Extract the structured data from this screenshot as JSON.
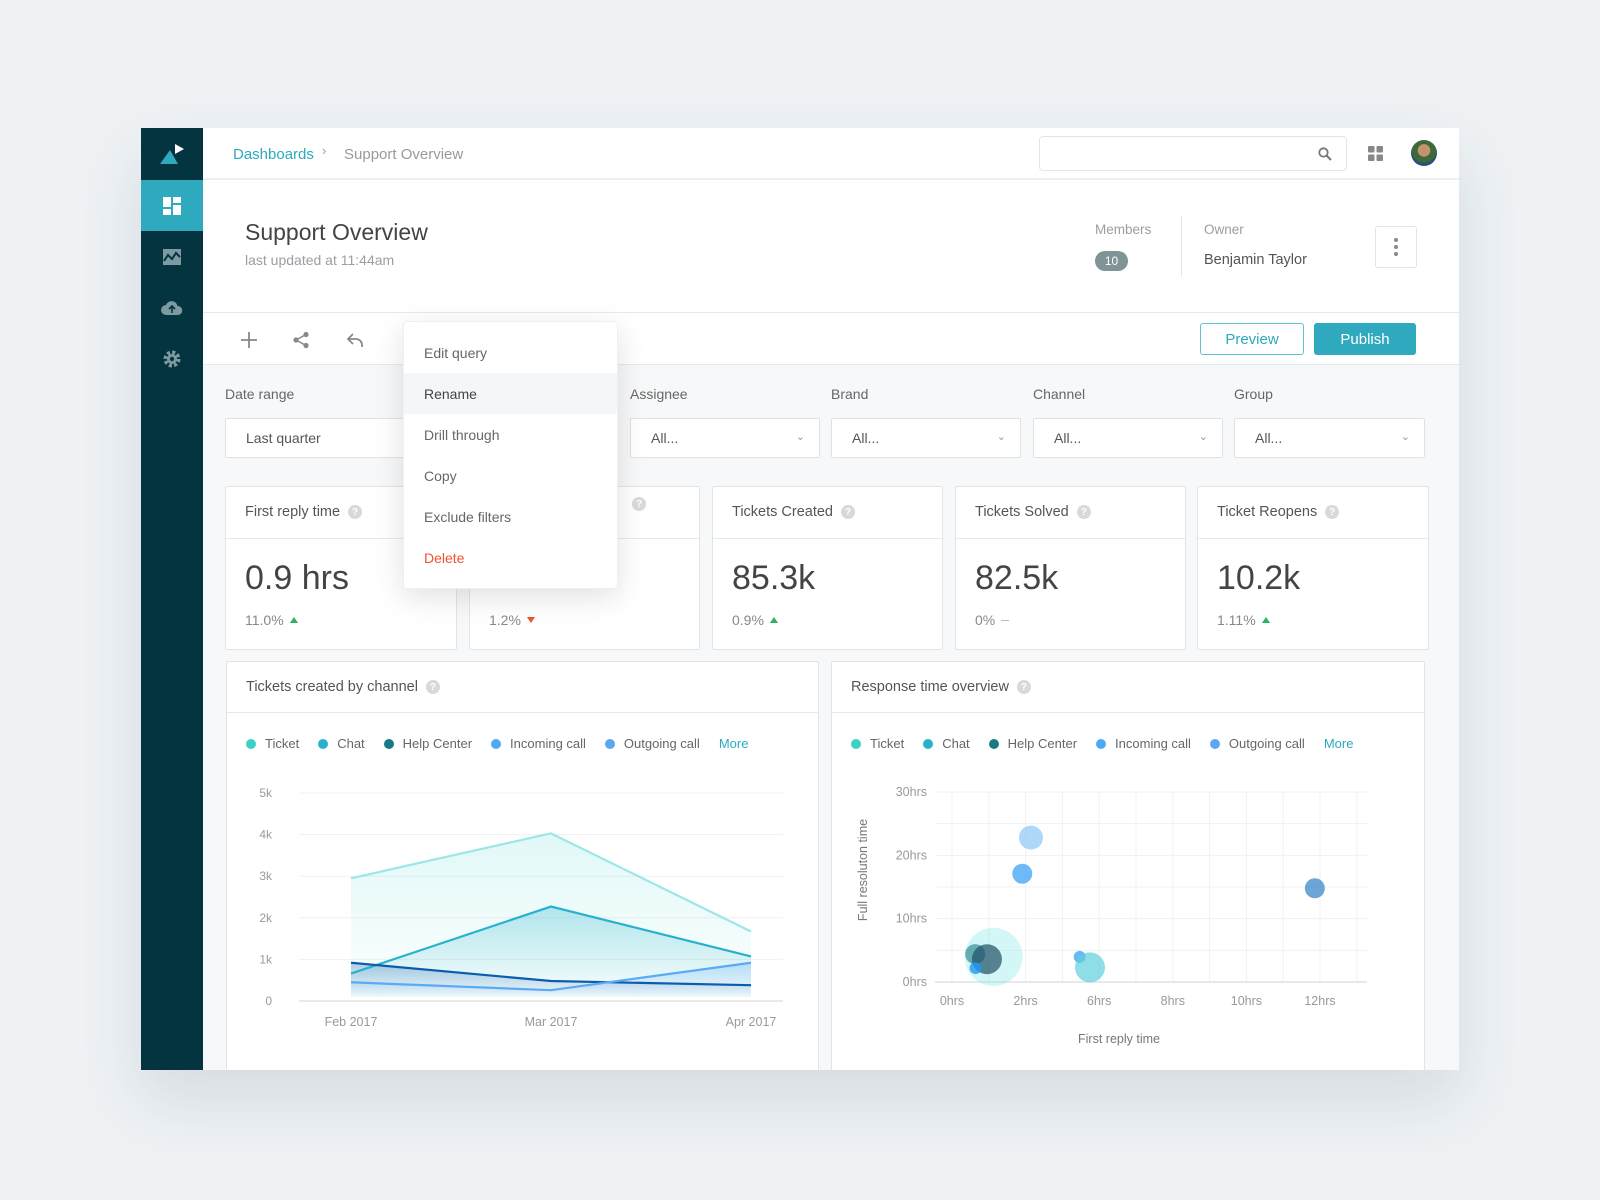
{
  "breadcrumb": {
    "root": "Dashboards",
    "separator": "›",
    "current": "Support Overview"
  },
  "search": {
    "placeholder": "",
    "value": ""
  },
  "header": {
    "title": "Support Overview",
    "subtitle": "last updated at 11:44am",
    "members_label": "Members",
    "members_count": "10",
    "owner_label": "Owner",
    "owner_name": "Benjamin Taylor"
  },
  "toolbar": {
    "preview": "Preview",
    "publish": "Publish"
  },
  "context_menu": {
    "items": [
      {
        "label": "Edit query"
      },
      {
        "label": "Rename",
        "highlighted": true
      },
      {
        "label": "Drill through"
      },
      {
        "label": "Copy"
      },
      {
        "label": "Exclude filters"
      },
      {
        "label": "Delete",
        "color": "#f0532e"
      }
    ]
  },
  "filters": [
    {
      "label": "Date range",
      "value": "Last quarter"
    },
    {
      "label": "Assignee",
      "value": "All..."
    },
    {
      "label": "Brand",
      "value": "All..."
    },
    {
      "label": "Channel",
      "value": "All..."
    },
    {
      "label": "Group",
      "value": "All..."
    }
  ],
  "kpis": [
    {
      "title": "First reply time",
      "value": "0.9 hrs",
      "delta": "11.0%",
      "trend": "up"
    },
    {
      "title": "",
      "value": "",
      "delta": "1.2%",
      "trend": "down"
    },
    {
      "title": "Tickets Created",
      "value": "85.3k",
      "delta": "0.9%",
      "trend": "up"
    },
    {
      "title": "Tickets Solved",
      "value": "82.5k",
      "delta": "0%",
      "trend": "flat"
    },
    {
      "title": "Ticket Reopens",
      "value": "10.2k",
      "delta": "1.11%",
      "trend": "up"
    }
  ],
  "legend": {
    "items": [
      {
        "label": "Ticket",
        "color": "#3ecfc6"
      },
      {
        "label": "Chat",
        "color": "#27b2cb"
      },
      {
        "label": "Help Center",
        "color": "#1a7a84"
      },
      {
        "label": "Incoming call",
        "color": "#4fa9f0"
      },
      {
        "label": "Outgoing call",
        "color": "#5ba7f3"
      }
    ],
    "more": "More"
  },
  "colors": {
    "accent": "#2ea9bd",
    "sidebar": "#04343f",
    "danger": "#f0532e",
    "success": "#27b35a"
  },
  "chart_data": [
    {
      "type": "area",
      "title": "Tickets created by channel",
      "categories": [
        "Feb 2017",
        "Mar 2017",
        "Apr 2017"
      ],
      "ylim": [
        0,
        5000
      ],
      "yticks": [
        {
          "v": 0,
          "label": "0"
        },
        {
          "v": 1000,
          "label": "1k"
        },
        {
          "v": 2000,
          "label": "2k"
        },
        {
          "v": 3000,
          "label": "3k"
        },
        {
          "v": 4000,
          "label": "4k"
        },
        {
          "v": 5000,
          "label": "5k"
        }
      ],
      "grid": true,
      "legend": "top-left",
      "series": [
        {
          "name": "Ticket",
          "values": [
            2950,
            4030,
            1670
          ],
          "color": "#9ae7e6"
        },
        {
          "name": "Chat",
          "values": [
            660,
            2270,
            1070
          ],
          "color": "#27b2cb"
        },
        {
          "name": "Help Center",
          "values": [
            920,
            480,
            380
          ],
          "color": "#0b5cab"
        },
        {
          "name": "Incoming call",
          "values": [
            450,
            260,
            920
          ],
          "color": "#5aaaf5"
        }
      ]
    },
    {
      "type": "scatter",
      "title": "Response time overview",
      "xlabel": "First reply time",
      "ylabel": "Full resoluton time",
      "xticks": [
        {
          "v": 0,
          "label": "0hrs"
        },
        {
          "v": 2,
          "label": "2hrs"
        },
        {
          "v": 6,
          "label": "6hrs"
        },
        {
          "v": 8,
          "label": "8hrs"
        },
        {
          "v": 10,
          "label": "10hrs"
        },
        {
          "v": 12,
          "label": "12hrs"
        }
      ],
      "yticks": [
        {
          "v": 0,
          "label": "0hrs"
        },
        {
          "v": 10,
          "label": "10hrs"
        },
        {
          "v": 20,
          "label": "20hrs"
        },
        {
          "v": 30,
          "label": "30hrs"
        }
      ],
      "ylim": [
        0,
        30
      ],
      "grid": true,
      "legend": "top-left",
      "points": [
        {
          "series": "Ticket",
          "x": 1.13,
          "y": 3.96,
          "size": 29,
          "color": "#7ee8e6",
          "opacity": 0.35
        },
        {
          "series": "Help Center",
          "x": 0.63,
          "y": 4.4,
          "size": 10,
          "color": "#1a7a84",
          "opacity": 0.6
        },
        {
          "series": "Help Center",
          "x": 0.95,
          "y": 3.6,
          "size": 15,
          "color": "#1f4f66",
          "opacity": 0.7
        },
        {
          "series": "Incoming call",
          "x": 0.64,
          "y": 2.2,
          "size": 6,
          "color": "#2196f3",
          "opacity": 0.8
        },
        {
          "series": "Incoming call",
          "x": 4.94,
          "y": 3.96,
          "size": 6,
          "color": "#42a5f5",
          "opacity": 0.8
        },
        {
          "series": "Chat",
          "x": 5.5,
          "y": 2.3,
          "size": 15,
          "color": "#5fcfdc",
          "opacity": 0.7
        },
        {
          "series": "Outgoing call",
          "x": 2.29,
          "y": 22.8,
          "size": 12,
          "color": "#8cc6f7",
          "opacity": 0.7
        },
        {
          "series": "Incoming call",
          "x": 1.91,
          "y": 17.1,
          "size": 10,
          "color": "#4aa8f5",
          "opacity": 0.8
        },
        {
          "series": "Outgoing call",
          "x": 11.86,
          "y": 14.8,
          "size": 10,
          "color": "#3b87c8",
          "opacity": 0.75
        }
      ]
    }
  ]
}
